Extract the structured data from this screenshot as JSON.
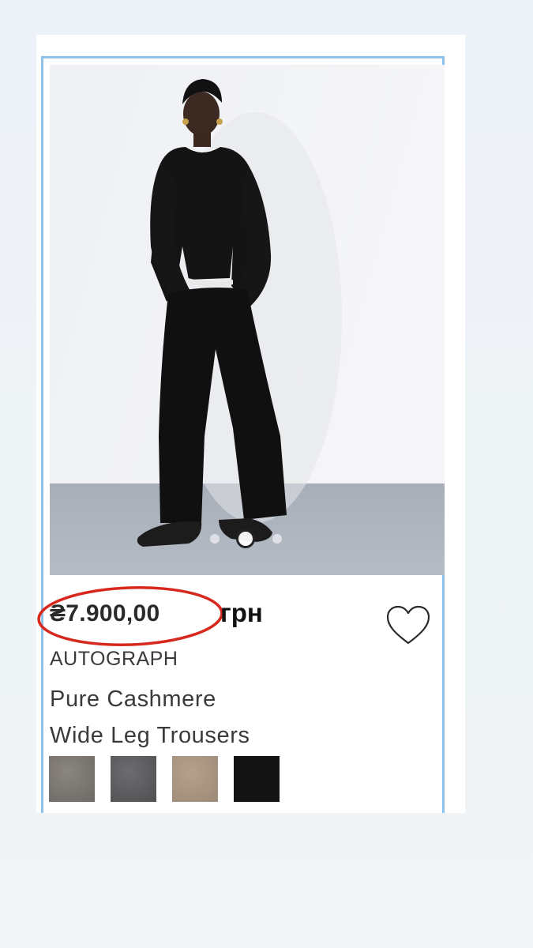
{
  "product": {
    "price": "₴7.900,00",
    "currency_label": "грн",
    "brand": "AUTOGRAPH",
    "name_line_1": "Pure Cashmere",
    "name_line_2": "Wide Leg Trousers",
    "image_alt": "Model wearing black knit top and wide leg trousers",
    "carousel": {
      "total": 3,
      "active": 2
    },
    "swatches": [
      {
        "name": "grey-brown",
        "color": "#7c7772"
      },
      {
        "name": "charcoal",
        "color": "#5e5e60"
      },
      {
        "name": "camel",
        "color": "#a89581"
      },
      {
        "name": "black",
        "color": "#141414"
      }
    ]
  },
  "colors": {
    "card_border": "#8ec2ea",
    "highlight_ring": "#d7281e",
    "text": "#3a3a3a"
  },
  "icons": {
    "favorite": "heart-outline-icon"
  }
}
